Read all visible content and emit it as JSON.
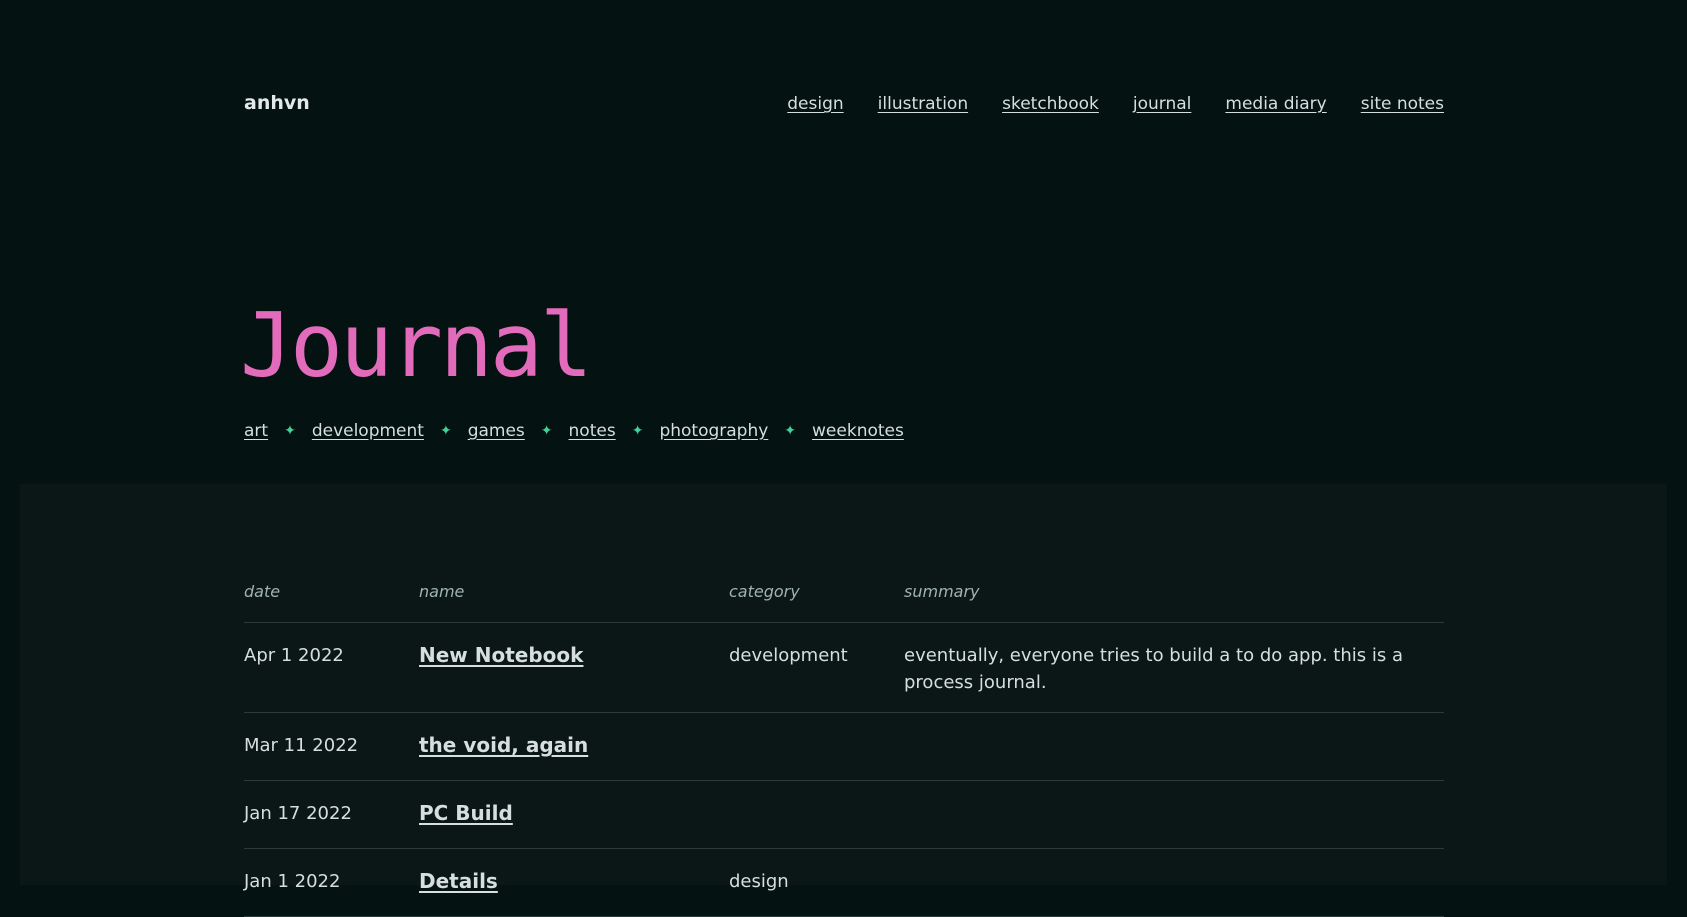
{
  "site": {
    "logo": "anhvn"
  },
  "nav": {
    "items": [
      {
        "label": "design"
      },
      {
        "label": "illustration"
      },
      {
        "label": "sketchbook"
      },
      {
        "label": "journal"
      },
      {
        "label": "media diary"
      },
      {
        "label": "site notes"
      }
    ]
  },
  "page": {
    "title": "Journal"
  },
  "tags": {
    "separator": "✦",
    "items": [
      {
        "label": "art"
      },
      {
        "label": "development"
      },
      {
        "label": "games"
      },
      {
        "label": "notes"
      },
      {
        "label": "photography"
      },
      {
        "label": "weeknotes"
      }
    ]
  },
  "table": {
    "headers": {
      "date": "date",
      "name": "name",
      "category": "category",
      "summary": "summary"
    },
    "rows": [
      {
        "date": "Apr 1 2022",
        "name": "New Notebook",
        "category": "development",
        "summary": "eventually, everyone tries to build a to do app. this is a process journal."
      },
      {
        "date": "Mar 11 2022",
        "name": "the void, again",
        "category": "",
        "summary": ""
      },
      {
        "date": "Jan 17 2022",
        "name": "PC Build",
        "category": "",
        "summary": ""
      },
      {
        "date": "Jan 1 2022",
        "name": "Details",
        "category": "design",
        "summary": ""
      }
    ]
  },
  "colors": {
    "background": "#051212",
    "panel": "#0b1717",
    "title_accent": "#e26bbb",
    "tag_separator": "#3fd39a",
    "text": "#d6dee0",
    "muted": "#9fb3ae"
  }
}
